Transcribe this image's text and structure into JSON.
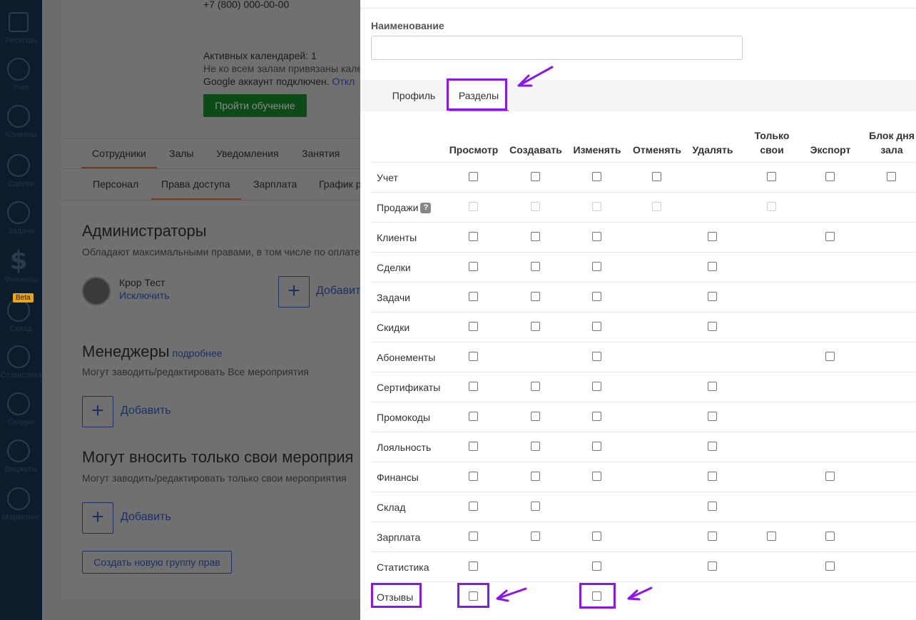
{
  "sidebar": {
    "items": [
      {
        "label": "Ресепшн",
        "icon": "home-icon"
      },
      {
        "label": "Учет",
        "icon": "calculator-icon"
      },
      {
        "label": "Клиенты",
        "icon": "client-icon"
      },
      {
        "label": "Сделки",
        "icon": "handshake-icon"
      },
      {
        "label": "Задачи",
        "icon": "tasks-icon"
      },
      {
        "label": "Финансы",
        "icon": "dollar-icon"
      },
      {
        "label": "Склад",
        "icon": "box-icon"
      },
      {
        "label": "Статистика",
        "icon": "statistics-icon"
      },
      {
        "label": "Скидки",
        "icon": "sale-tag-icon"
      },
      {
        "label": "Виджеты",
        "icon": "widgets-icon"
      },
      {
        "label": "Маркетинг",
        "icon": "marketing-icon"
      }
    ],
    "beta_badge": "Beta"
  },
  "background": {
    "phone": "+7 (800) 000-00-00",
    "calendars": "Активных календарей: 1",
    "halls_note": "Не ко всем залам привязаны кале",
    "google_note": "Google аккаунт подключен.",
    "google_link": "Откл",
    "training_button": "Пройти обучение",
    "main_tabs": [
      "Сотрудники",
      "Залы",
      "Уведомления",
      "Занятия"
    ],
    "sub_tabs": [
      "Персонал",
      "Права доступа",
      "Зарплата",
      "График р"
    ],
    "admins_title": "Администраторы",
    "admins_desc": "Обладают максимальными правами, в том числе по оплате",
    "admin_name": "Кроp Тест",
    "admin_exclude": "Исключить",
    "add_label": "Добавить",
    "managers_title": "Менеджеры",
    "managers_more": "подробнее",
    "managers_desc": "Могут заводить/редактировать Все мероприятия",
    "own_title": "Могут вносить только свои мероприя",
    "own_desc": "Могут заводить/редактировать только свои мероприятия",
    "create_group_button": "Создать новую группу прав"
  },
  "panel": {
    "name_label": "Наименование",
    "name_value": "",
    "tabs": [
      {
        "label": "Профиль",
        "active": false
      },
      {
        "label": "Разделы",
        "active": true
      }
    ],
    "columns": [
      "Просмотр",
      "Создавать",
      "Изменять",
      "Отменять",
      "Удалять",
      "Только свои",
      "Экспорт",
      "Блок дня зала"
    ],
    "rows": [
      {
        "label": "Учет",
        "help": false,
        "cells": [
          "cb",
          "cb",
          "cb",
          "cb",
          "",
          "cb",
          "cb",
          "cb"
        ]
      },
      {
        "label": "Продажи",
        "help": true,
        "help_text": "?",
        "cells": [
          "dis",
          "dis",
          "dis",
          "dis",
          "",
          "dis",
          "",
          ""
        ]
      },
      {
        "label": "Клиенты",
        "help": false,
        "cells": [
          "cb",
          "cb",
          "cb",
          "",
          "cb",
          "",
          "cb",
          ""
        ]
      },
      {
        "label": "Сделки",
        "help": false,
        "cells": [
          "cb",
          "cb",
          "cb",
          "",
          "cb",
          "",
          "",
          ""
        ]
      },
      {
        "label": "Задачи",
        "help": false,
        "cells": [
          "cb",
          "cb",
          "cb",
          "",
          "cb",
          "",
          "",
          ""
        ]
      },
      {
        "label": "Скидки",
        "help": false,
        "cells": [
          "cb",
          "cb",
          "cb",
          "",
          "cb",
          "",
          "",
          ""
        ]
      },
      {
        "label": "Абонементы",
        "help": false,
        "cells": [
          "cb",
          "",
          "cb",
          "",
          "",
          "",
          "cb",
          ""
        ]
      },
      {
        "label": "Сертификаты",
        "help": false,
        "cells": [
          "cb",
          "cb",
          "cb",
          "",
          "cb",
          "",
          "",
          ""
        ]
      },
      {
        "label": "Промокоды",
        "help": false,
        "cells": [
          "cb",
          "cb",
          "cb",
          "",
          "cb",
          "",
          "",
          ""
        ]
      },
      {
        "label": "Лояльность",
        "help": false,
        "cells": [
          "cb",
          "cb",
          "cb",
          "",
          "cb",
          "",
          "",
          ""
        ]
      },
      {
        "label": "Финансы",
        "help": false,
        "cells": [
          "cb",
          "cb",
          "cb",
          "",
          "cb",
          "",
          "cb",
          ""
        ]
      },
      {
        "label": "Склад",
        "help": false,
        "cells": [
          "cb",
          "cb",
          "",
          "",
          "cb",
          "",
          "",
          ""
        ]
      },
      {
        "label": "Зарплата",
        "help": false,
        "cells": [
          "cb",
          "cb",
          "cb",
          "",
          "cb",
          "cb",
          "cb",
          ""
        ]
      },
      {
        "label": "Статистика",
        "help": false,
        "cells": [
          "cb",
          "",
          "cb",
          "",
          "cb",
          "",
          "cb",
          ""
        ]
      },
      {
        "label": "Отзывы",
        "help": false,
        "cells": [
          "cb",
          "",
          "cb",
          "",
          "",
          "",
          "",
          ""
        ]
      }
    ]
  },
  "annotation_color": "#8a17e8"
}
